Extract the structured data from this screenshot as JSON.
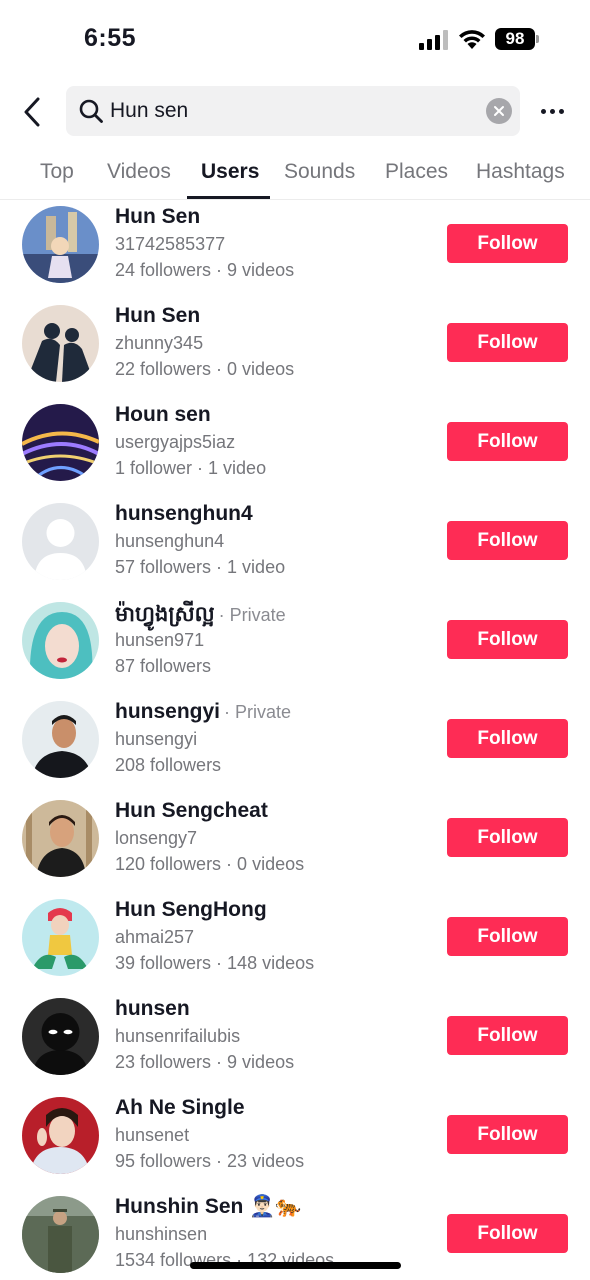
{
  "status_bar": {
    "time": "6:55",
    "battery": "98",
    "icons": [
      "cellular-signal-icon",
      "wifi-icon",
      "battery-icon"
    ]
  },
  "search": {
    "query": "Hun sen",
    "icons": [
      "back-arrow-icon",
      "search-icon",
      "clear-icon",
      "more-icon"
    ]
  },
  "tabs": [
    {
      "label": "Top",
      "active": false
    },
    {
      "label": "Videos",
      "active": false
    },
    {
      "label": "Users",
      "active": true
    },
    {
      "label": "Sounds",
      "active": false
    },
    {
      "label": "Places",
      "active": false
    },
    {
      "label": "Hashtags",
      "active": false
    }
  ],
  "follow_label": "Follow",
  "colors": {
    "follow_button": "#fe2c55",
    "text_primary": "#161823",
    "text_secondary": "#75767b",
    "search_bg": "#f1f1f2"
  },
  "users": [
    {
      "name": "Hun Sen",
      "private": "",
      "handle": "31742585377",
      "stats": "24 followers · 9 videos"
    },
    {
      "name": "Hun Sen",
      "private": "",
      "handle": "zhunny345",
      "stats": "22 followers · 0 videos"
    },
    {
      "name": "Houn sen",
      "private": "",
      "handle": "usergyajps5iaz",
      "stats": "1 follower · 1 video"
    },
    {
      "name": "hunsenghun4",
      "private": "",
      "handle": "hunsenghun4",
      "stats": "57 followers · 1 video"
    },
    {
      "name": "ម៉ាហ្វូងស្រីល្អ",
      "private": "· Private",
      "handle": "hunsen971",
      "stats": "87 followers"
    },
    {
      "name": "hunsengyi",
      "private": "· Private",
      "handle": "hunsengyi",
      "stats": "208 followers"
    },
    {
      "name": "Hun Sengcheat",
      "private": "",
      "handle": "lonsengy7",
      "stats": "120 followers · 0 videos"
    },
    {
      "name": "Hun SengHong",
      "private": "",
      "handle": "ahmai257",
      "stats": "39 followers · 148 videos"
    },
    {
      "name": "hunsen",
      "private": "",
      "handle": "hunsenrifailubis",
      "stats": "23 followers · 9 videos"
    },
    {
      "name": "Ah Ne Single",
      "private": "",
      "handle": "hunsenet",
      "stats": "95 followers · 23 videos"
    },
    {
      "name": "Hunshin Sen 👮🏻‍♂️🐅",
      "private": "",
      "handle": "hunshinsen",
      "stats": "1534 followers · 132 videos"
    }
  ]
}
